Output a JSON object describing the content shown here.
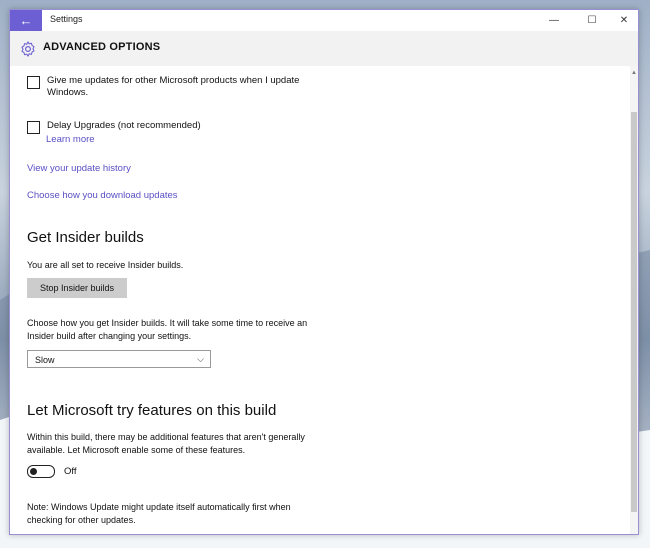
{
  "window": {
    "title": "Settings",
    "back_glyph": "←",
    "minimize_glyph": "—",
    "maximize_glyph": "☐",
    "close_glyph": "✕"
  },
  "header": {
    "title": "ADVANCED OPTIONS",
    "icon": "gear-icon"
  },
  "options": {
    "updates_other_products": "Give me updates for other Microsoft products when I update Windows.",
    "delay_upgrades": "Delay Upgrades (not recommended)",
    "learn_more": "Learn more"
  },
  "links": {
    "update_history": "View your update history",
    "download_updates": "Choose how you download updates"
  },
  "insider": {
    "heading": "Get Insider builds",
    "status": "You are all set to receive Insider builds.",
    "stop_button": "Stop Insider builds",
    "choose_text": "Choose how you get Insider builds. It will take some time to receive an Insider build after changing your settings.",
    "selected_ring": "Slow"
  },
  "features": {
    "heading": "Let Microsoft try features on this build",
    "description": "Within this build, there may be additional features that aren't generally available. Let Microsoft enable some of these features.",
    "toggle_state": "Off"
  },
  "note": "Note: Windows Update might update itself automatically first when checking for other updates.",
  "colors": {
    "accent": "#6b5fd3",
    "link": "#5a4fc4",
    "button_bg": "#cccccc"
  }
}
